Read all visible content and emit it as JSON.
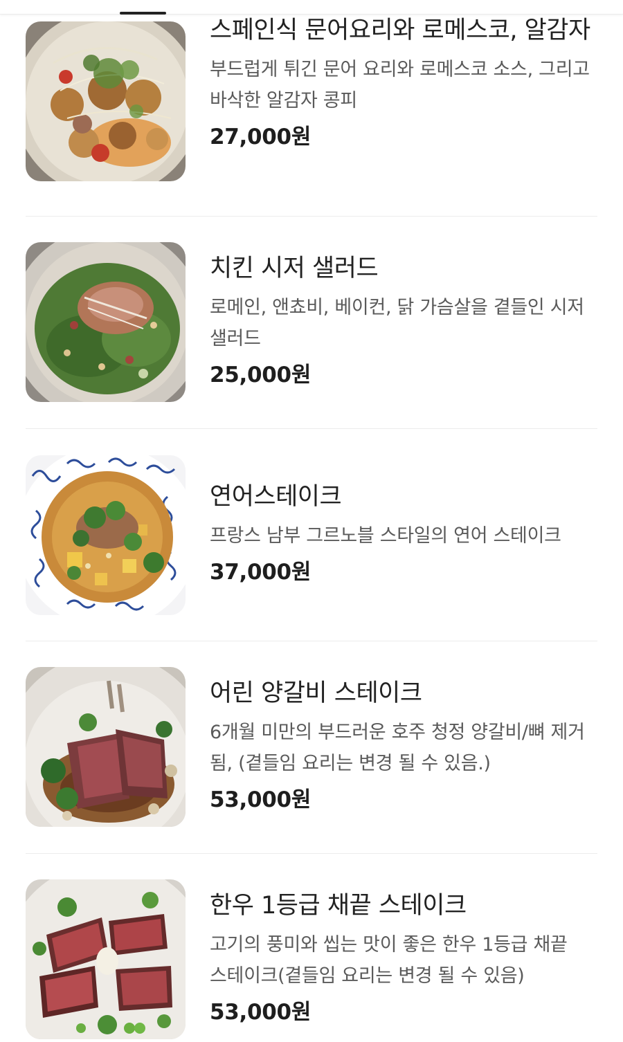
{
  "menu": {
    "items": [
      {
        "name": "스페인식 문어요리와 로메스코, 알감자",
        "description": "부드럽게 튀긴 문어 요리와 로메스코 소스, 그리고 바삭한 알감자 콩피",
        "price": "27,000원",
        "photo_icon": "octopus-dish-photo"
      },
      {
        "name": "치킨 시저 샐러드",
        "description": "로메인, 앤쵸비, 베이컨, 닭 가슴살을 곁들인 시저 샐러드",
        "price": "25,000원",
        "photo_icon": "caesar-salad-photo"
      },
      {
        "name": "연어스테이크",
        "description": "프랑스 남부 그르노블 스타일의 연어 스테이크",
        "price": "37,000원",
        "photo_icon": "salmon-steak-photo"
      },
      {
        "name": "어린 양갈비 스테이크",
        "description": "6개월 미만의 부드러운 호주 청정 양갈비/뼈 제거 됨, (곁들임 요리는 변경 될 수 있음.)",
        "price": "53,000원",
        "photo_icon": "lamb-rack-photo"
      },
      {
        "name": "한우 1등급 채끝 스테이크",
        "description": "고기의 풍미와 씹는 맛이 좋은 한우 1등급 채끝 스테이크(곁들임 요리는 변경 될 수 있음)",
        "price": "53,000원",
        "photo_icon": "hanwoo-steak-photo"
      }
    ]
  },
  "colors": {
    "text_primary": "#222222",
    "text_secondary": "#5a5a5a",
    "divider": "#ececec",
    "tab_indicator": "#222222"
  }
}
